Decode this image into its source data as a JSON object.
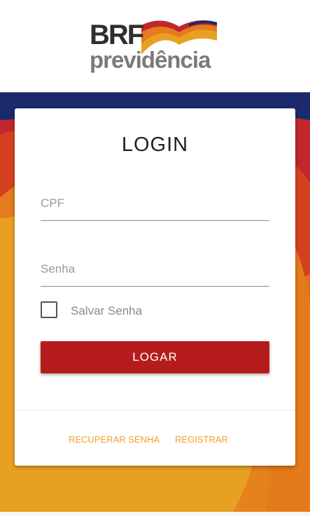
{
  "logo": {
    "brand_top": "BRF",
    "brand_bottom": "previdência"
  },
  "colors": {
    "navy": "#1c2a6b",
    "red": "#c1272d",
    "orange": "#e57a1e",
    "gold": "#e8a023",
    "button": "#b71c1c",
    "link": "#f2a12a"
  },
  "login": {
    "title": "LOGIN",
    "cpf_placeholder": "CPF",
    "senha_placeholder": "Senha",
    "save_password_label": "Salvar Senha",
    "login_button": "LOGAR"
  },
  "footer": {
    "recover_link": "RECUPERAR SENHA",
    "register_link": "REGISTRAR"
  }
}
